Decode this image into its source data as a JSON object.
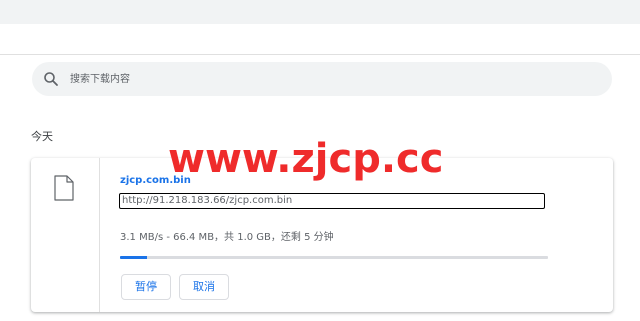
{
  "search": {
    "placeholder": "搜索下载内容",
    "icon": "search-icon"
  },
  "section": {
    "date_label": "今天"
  },
  "download": {
    "file_icon": "file-icon",
    "file_name": "zjcp.com.bin",
    "url": "http://91.218.183.66/zjcp.com.bin",
    "status": "3.1 MB/s - 66.4 MB，共 1.0 GB，还剩 5 分钟",
    "progress_fraction": 0.064,
    "pause_label": "暂停",
    "cancel_label": "取消"
  },
  "watermark": {
    "text": "www.zjcp.cc",
    "color": "#ef2b2b"
  },
  "colors": {
    "accent": "#1a73e8",
    "topbar": "#f1f3f4"
  }
}
